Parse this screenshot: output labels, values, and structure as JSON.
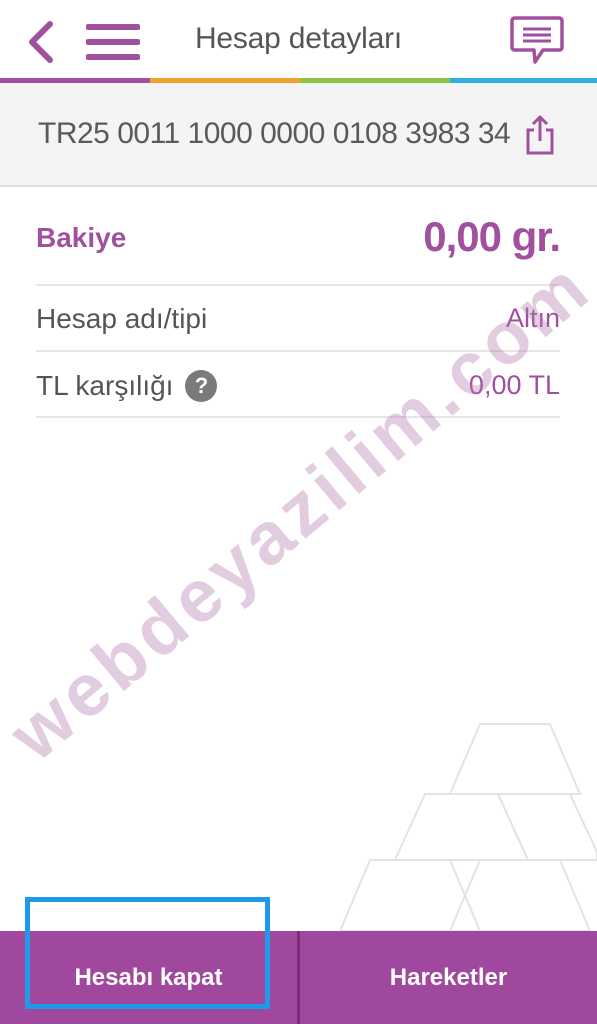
{
  "header": {
    "title": "Hesap detayları",
    "back_icon": "chevron-left-icon",
    "menu_icon": "hamburger-menu-icon",
    "message_icon": "chat-bubble-icon",
    "icon_color": "#a0509f"
  },
  "color_bar": [
    "#a0509f",
    "#f0a02d",
    "#8cc63f",
    "#33aee0"
  ],
  "account": {
    "iban": "TR25 0011 1000 0000 0108 3983 34",
    "share_icon": "share-icon"
  },
  "details": {
    "balance_label": "Bakiye",
    "balance_value": "0,00 gr.",
    "name_type_label": "Hesap adı/tipi",
    "name_type_value": "Altın",
    "tl_label": "TL karşılığı",
    "tl_value": "0,00 TL",
    "help_icon": "?"
  },
  "watermark": "webdeyazilim.com",
  "footer": {
    "close_account": "Hesabı kapat",
    "transactions": "Hareketler",
    "background_color": "#a0489e",
    "highlight_color": "#1e9be8"
  }
}
